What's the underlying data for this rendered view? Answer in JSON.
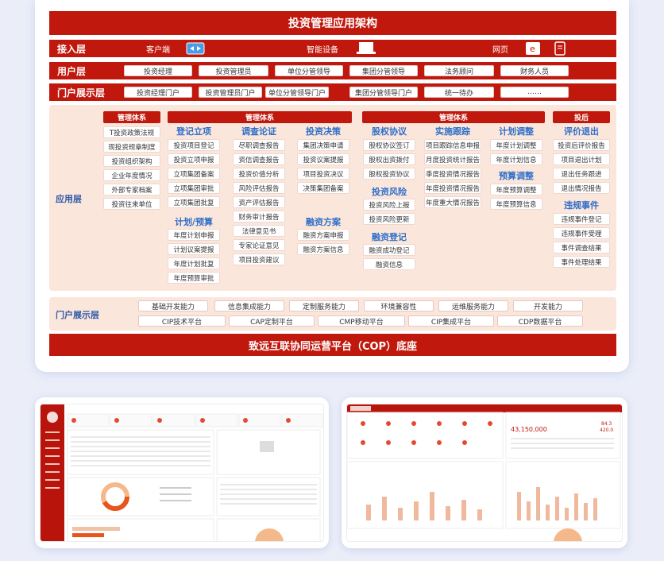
{
  "title": "投资管理应用架构",
  "access_layer": {
    "label": "接入层",
    "client": "客户端",
    "device": "智能设备",
    "web": "网页"
  },
  "user_layer": {
    "label": "用户层",
    "items": [
      "投资经理",
      "投资管理员",
      "单位分管领导",
      "集团分管领导",
      "法务顾问",
      "财务人员"
    ]
  },
  "portal_layer": {
    "label": "门户展示层",
    "items": [
      "投资经理门户",
      "投资管理员门户",
      "单位分管领导门户",
      "集团分管领导门户",
      "统一待办",
      "……"
    ]
  },
  "app_layer": {
    "label": "应用层",
    "group1": {
      "header": "管理体系",
      "items": [
        "T投资政策法规",
        "现投资规章制度",
        "投资组织架构",
        "企业年度情况",
        "外部专家档案",
        "投资往来单位"
      ]
    },
    "group2": {
      "header": "管理体系",
      "approval": {
        "title": "登记立项",
        "items": [
          "投资项目登记",
          "投资立项申报",
          "立项集团备案",
          "立项集团审批",
          "立项集团批复"
        ]
      },
      "plan": {
        "title": "计划/预算",
        "items": [
          "年度计划申报",
          "计划议案提报",
          "年度计划批复",
          "年度预算审批"
        ]
      },
      "research": {
        "title": "调查论证",
        "items": [
          "尽职调查报告",
          "资信调查报告",
          "投资价值分析",
          "风险评估报告",
          "资产评估报告",
          "财务审计报告",
          "法律意见书",
          "专家论证意见",
          "项目投资建议"
        ]
      },
      "decision": {
        "title": "投资决策",
        "items": [
          "集团决策申请",
          "投资议案提报",
          "项目投资决议",
          "决策集团备案"
        ]
      },
      "financing": {
        "title": "融资方案",
        "items": [
          "融资方案申报",
          "融资方案信息"
        ]
      }
    },
    "group3": {
      "header": "管理体系",
      "equity": {
        "title": "股权协议",
        "items": [
          "股权协议签订",
          "股权出资拨付",
          "股权投资协议"
        ]
      },
      "risk": {
        "title": "投资风险",
        "items": [
          "投资风险上报",
          "投资风险更新"
        ]
      },
      "fin_reg": {
        "title": "融资登记",
        "items": [
          "融资成功登记",
          "融资信息"
        ]
      },
      "tracking": {
        "title": "实施跟踪",
        "items": [
          "项目跟踪信息申报",
          "月度投资统计报告",
          "季度投资情况报告",
          "年度投资情况报告",
          "年度重大情况报告"
        ]
      },
      "plan_adj": {
        "title": "计划调整",
        "items": [
          "年度计划调整",
          "年度计划信息"
        ]
      },
      "budget_adj": {
        "title": "预算调整",
        "items": [
          "年度预算调整",
          "年度预算信息"
        ]
      }
    },
    "group4": {
      "header": "投后",
      "exit": {
        "title": "评价退出",
        "items": [
          "投资后评价报告",
          "项目退出计划",
          "退出任务跟进",
          "退出情况报告"
        ]
      },
      "violation": {
        "title": "违规事件",
        "items": [
          "违规事件登记",
          "违规事件受理",
          "事件调查结果",
          "事件处理结果"
        ]
      }
    }
  },
  "portal_layer2": {
    "label": "门户展示层",
    "row1": [
      "基础开发能力",
      "信息集成能力",
      "定制服务能力",
      "环境兼容性",
      "运维服务能力",
      "开发能力"
    ],
    "row2": [
      "CIP技术平台",
      "CAP定制平台",
      "CMP移动平台",
      "CIP集成平台",
      "CDP数据平台"
    ]
  },
  "base_platform": "致远互联协同运营平台（COP）底座",
  "screenshot2": {
    "amount": "43,150,000",
    "val1": "84.3",
    "val2": "420.0"
  },
  "colors": {
    "primary": "#c0180d",
    "accent_orange": "#e9541d",
    "peach": "#fbe6dc",
    "blue_text": "#2e6fc9"
  }
}
